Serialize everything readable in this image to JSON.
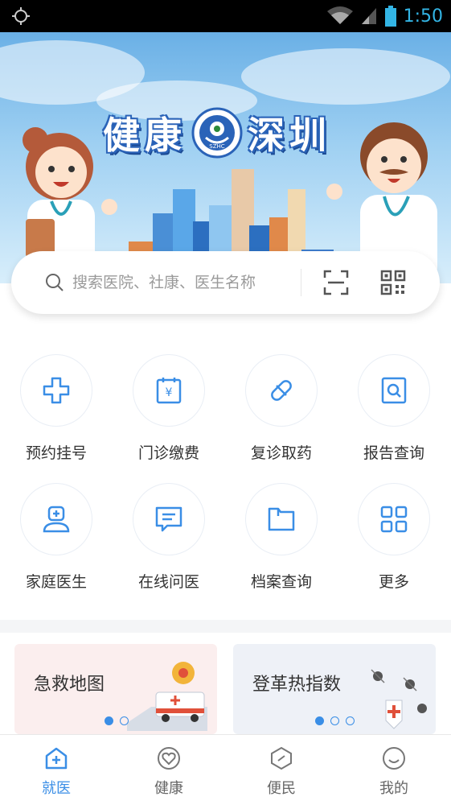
{
  "status_bar": {
    "time": "1:50"
  },
  "banner": {
    "title_left": "健康",
    "title_right": "深圳",
    "logo_text": "SZHC"
  },
  "search": {
    "placeholder": "搜索医院、社康、医生名称"
  },
  "services": [
    {
      "label": "预约挂号",
      "icon": "plus-cross-icon"
    },
    {
      "label": "门诊缴费",
      "icon": "yuan-bill-icon"
    },
    {
      "label": "复诊取药",
      "icon": "pill-icon"
    },
    {
      "label": "报告查询",
      "icon": "report-search-icon"
    },
    {
      "label": "家庭医生",
      "icon": "doctor-icon"
    },
    {
      "label": "在线问医",
      "icon": "chat-icon"
    },
    {
      "label": "档案查询",
      "icon": "folder-icon"
    },
    {
      "label": "更多",
      "icon": "grid-icon"
    }
  ],
  "cards": [
    {
      "title": "急救地图"
    },
    {
      "title": "登革热指数"
    }
  ],
  "tabs": [
    {
      "label": "就医",
      "active": true,
      "icon": "hospital-icon"
    },
    {
      "label": "健康",
      "active": false,
      "icon": "heart-icon"
    },
    {
      "label": "便民",
      "active": false,
      "icon": "shield-icon"
    },
    {
      "label": "我的",
      "active": false,
      "icon": "smile-icon"
    }
  ],
  "colors": {
    "accent": "#3a8ee6",
    "banner_sky": "#6ab0e6"
  }
}
